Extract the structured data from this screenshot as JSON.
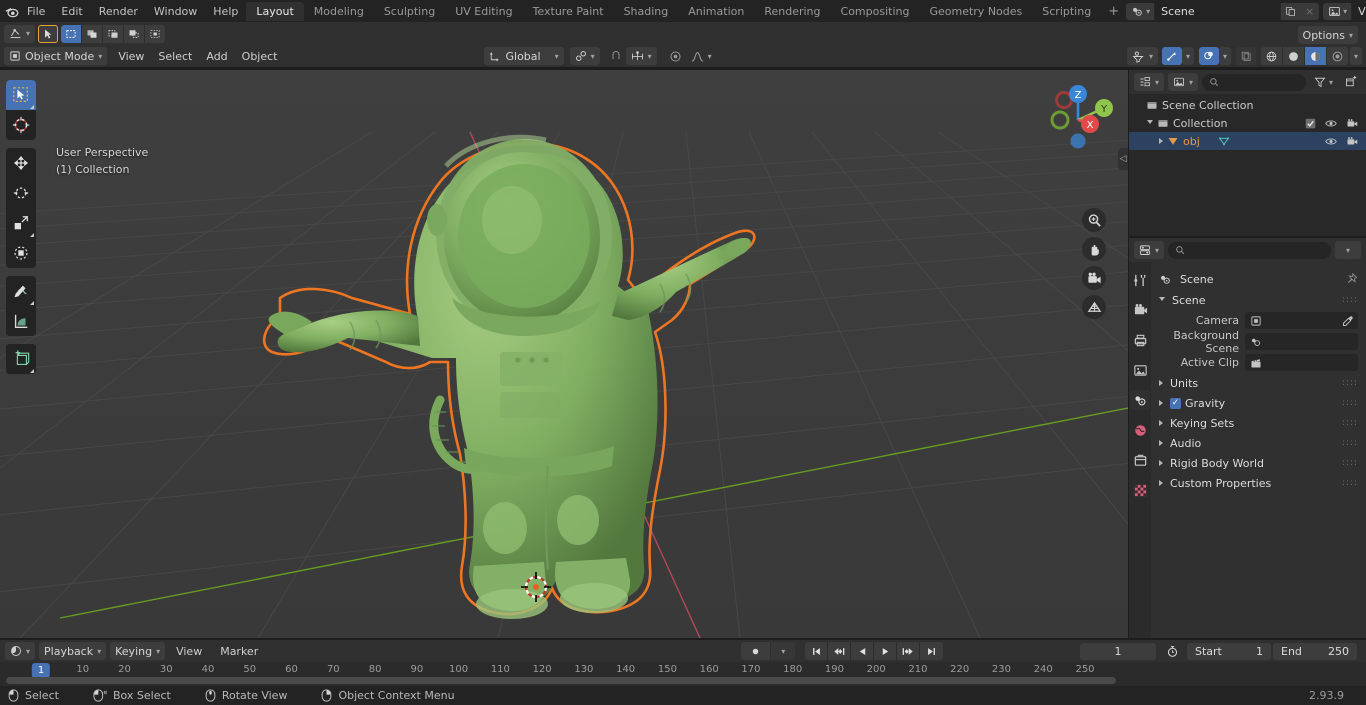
{
  "app": {
    "name": "Blender",
    "version": "2.93.9"
  },
  "topbar": {
    "menus": [
      "File",
      "Edit",
      "Render",
      "Window",
      "Help"
    ],
    "workspaces": [
      {
        "label": "Layout",
        "active": true
      },
      {
        "label": "Modeling",
        "active": false
      },
      {
        "label": "Sculpting",
        "active": false
      },
      {
        "label": "UV Editing",
        "active": false
      },
      {
        "label": "Texture Paint",
        "active": false
      },
      {
        "label": "Shading",
        "active": false
      },
      {
        "label": "Animation",
        "active": false
      },
      {
        "label": "Rendering",
        "active": false
      },
      {
        "label": "Compositing",
        "active": false
      },
      {
        "label": "Geometry Nodes",
        "active": false
      },
      {
        "label": "Scripting",
        "active": false
      }
    ],
    "add_workspace_label": "+",
    "scene": {
      "name": "Scene",
      "new_label": "",
      "unlink_label": "×"
    },
    "view_layer": {
      "name": "View Layer",
      "new_label": "",
      "unlink_label": "×"
    }
  },
  "viewport_header": {
    "editor_type": "editor-type-3d-viewport",
    "mode": "Object Mode",
    "menus": [
      "View",
      "Select",
      "Add",
      "Object"
    ],
    "transform_orientation": "Global",
    "options_label": "Options",
    "select_modes": [
      "tweak",
      "select-box",
      "select-circle",
      "select-lasso",
      "select-extend"
    ],
    "snap_enabled": false,
    "proportional_editing": false
  },
  "viewport": {
    "perspective_label": "User Perspective",
    "collection_label": "(1) Collection",
    "gizmo_axes": [
      {
        "label": "X",
        "color": "#e04a4a"
      },
      {
        "label": "Y",
        "color": "#8ec54a"
      },
      {
        "label": "Z",
        "color": "#3b86d6"
      }
    ],
    "object_color": "#7fae61",
    "selection_outline_color": "#ed7622",
    "background_color": "#3b3b3b",
    "grid_color": "#4a4a4a",
    "axis_x_color": "#c94a5c",
    "axis_y_color": "#6aa81f",
    "toolbar_tools": [
      "tweak-select-tool",
      "cursor-tool",
      "move-tool",
      "rotate-tool",
      "scale-tool",
      "transform-tool",
      "annotate-tool",
      "measure-tool",
      "add-cube-tool"
    ],
    "nav_buttons": [
      "zoom-tool",
      "pan-tool",
      "camera-view-tool",
      "toggle-ortho-tool"
    ]
  },
  "outliner": {
    "search_placeholder": "",
    "rows": [
      {
        "label": "Scene Collection",
        "indent": 0,
        "icon": "collection-icon",
        "selected": false,
        "expander": "none",
        "checkbox": false,
        "eye": false,
        "camera": false
      },
      {
        "label": "Collection",
        "indent": 1,
        "icon": "collection-icon",
        "selected": false,
        "expander": "down",
        "checkbox": true,
        "eye": true,
        "camera": true
      },
      {
        "label": "obj",
        "indent": 2,
        "icon": "mesh-object-icon",
        "selected": true,
        "expander": "right",
        "checkbox": false,
        "eye": true,
        "camera": true
      }
    ]
  },
  "properties": {
    "search_placeholder": "",
    "tabs": [
      "tool-tab",
      "render-tab",
      "output-tab",
      "view-layer-tab",
      "scene-tab",
      "world-tab",
      "object-tab",
      "texture-tab"
    ],
    "active_tab_index": 4,
    "breadcrumb": "Scene",
    "panels": [
      {
        "label": "Scene",
        "open": true,
        "checkbox": false
      },
      {
        "label": "Units",
        "open": false,
        "checkbox": false
      },
      {
        "label": "Gravity",
        "open": false,
        "checkbox": true
      },
      {
        "label": "Keying Sets",
        "open": false,
        "checkbox": false
      },
      {
        "label": "Audio",
        "open": false,
        "checkbox": false
      },
      {
        "label": "Rigid Body World",
        "open": false,
        "checkbox": false
      },
      {
        "label": "Custom Properties",
        "open": false,
        "checkbox": false
      }
    ],
    "scene_fields": [
      {
        "label": "Camera",
        "value": "",
        "icon": "camera-data-icon",
        "eyedropper": true
      },
      {
        "label": "Background Scene",
        "value": "",
        "icon": "scene-icon",
        "eyedropper": false
      },
      {
        "label": "Active Clip",
        "value": "",
        "icon": "movie-clip-icon",
        "eyedropper": false
      }
    ]
  },
  "timeline": {
    "editor_type": "editor-type-timeline",
    "menus": [
      "Playback",
      "Keying",
      "View",
      "Marker"
    ],
    "auto_keying": "record-icon",
    "transport": [
      "jump-to-start",
      "jump-prev-keyframe",
      "play-reverse",
      "play",
      "jump-next-keyframe",
      "jump-to-end"
    ],
    "current_frame": "1",
    "start_label": "Start",
    "start_value": "1",
    "end_label": "End",
    "end_value": "250",
    "ticks": [
      "1",
      "10",
      "20",
      "30",
      "40",
      "50",
      "60",
      "70",
      "80",
      "90",
      "100",
      "110",
      "120",
      "130",
      "140",
      "150",
      "160",
      "170",
      "180",
      "190",
      "200",
      "210",
      "220",
      "230",
      "240",
      "250"
    ],
    "playhead_frame": "1"
  },
  "status_bar": {
    "items": [
      {
        "icon": "mouse-left-icon",
        "label": "Select"
      },
      {
        "icon": "mouse-left-drag-icon",
        "label": "Box Select"
      },
      {
        "icon": "mouse-middle-icon",
        "label": "Rotate View"
      },
      {
        "icon": "mouse-right-icon",
        "label": "Object Context Menu"
      }
    ],
    "version": "2.93.9"
  }
}
